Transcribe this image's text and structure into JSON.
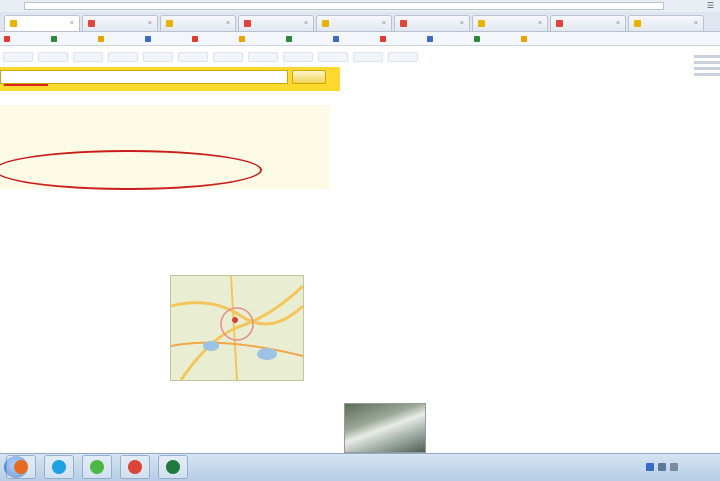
{
  "browser": {
    "address": "",
    "tabs": [
      {
        "label": "",
        "color": "#e9b400"
      },
      {
        "label": "",
        "color": "#e0443a"
      },
      {
        "label": "",
        "color": "#e9b400"
      },
      {
        "label": "",
        "color": "#e0443a"
      },
      {
        "label": "",
        "color": "#e9b400"
      },
      {
        "label": "",
        "color": "#e0443a"
      },
      {
        "label": "",
        "color": "#e9b400"
      },
      {
        "label": "",
        "color": "#e0443a"
      },
      {
        "label": "",
        "color": "#e9b400"
      }
    ],
    "bookmarks": [
      {
        "label": "",
        "color": "#e03b2f"
      },
      {
        "label": "",
        "color": "#2a8a3a"
      },
      {
        "label": "",
        "color": "#e9a400"
      },
      {
        "label": "",
        "color": "#3a6bc9"
      },
      {
        "label": "",
        "color": "#e03b2f"
      },
      {
        "label": "",
        "color": "#e9a400"
      },
      {
        "label": "",
        "color": "#2a8a3a"
      },
      {
        "label": "",
        "color": "#3a6bc9"
      },
      {
        "label": "",
        "color": "#e03b2f"
      },
      {
        "label": "",
        "color": "#3a6bc9"
      },
      {
        "label": "",
        "color": "#2a8a3a"
      },
      {
        "label": "",
        "color": "#e9a400"
      }
    ]
  },
  "page": {
    "services": [
      "",
      "",
      "",
      "",
      "",
      "",
      "",
      "",
      "",
      "",
      "",
      ""
    ],
    "search": {
      "query": "",
      "button": ""
    },
    "ads_label": "",
    "ads": [
      {
        "title": "",
        "text": "",
        "url": ""
      },
      {
        "title": "",
        "text": "",
        "url": ""
      }
    ],
    "results": [
      {
        "title": "",
        "text": "",
        "url": "",
        "sitelinks": [
          "",
          "",
          "",
          "",
          ""
        ]
      },
      {
        "title": "",
        "text": "",
        "url": ""
      },
      {
        "title": "",
        "text": "",
        "url": ""
      }
    ],
    "right_ads": [
      {
        "title": "",
        "text": "",
        "url": ""
      },
      {
        "title": "",
        "text": "",
        "url": ""
      },
      {
        "title": "",
        "text": "",
        "url": ""
      },
      {
        "title": "",
        "text": "",
        "url": ""
      },
      {
        "title": "",
        "text": "",
        "url": ""
      },
      {
        "title": "",
        "text": "",
        "url": ""
      }
    ],
    "colors": {
      "band": "#ffd92e",
      "link": "#1a3bbd",
      "url": "#2c8a2c",
      "mark": "#cc1b1b"
    }
  },
  "taskbar": {
    "apps": [
      {
        "icon": "firefox-icon",
        "color": "#e76a1f"
      },
      {
        "icon": "skype-icon",
        "color": "#1ea1e1"
      },
      {
        "icon": "utorrent-icon",
        "color": "#4cb848"
      },
      {
        "icon": "chrome-icon",
        "color": "#db4437"
      },
      {
        "icon": "excel-icon",
        "color": "#1f7a3e"
      }
    ],
    "clock_time": "",
    "clock_date": ""
  }
}
